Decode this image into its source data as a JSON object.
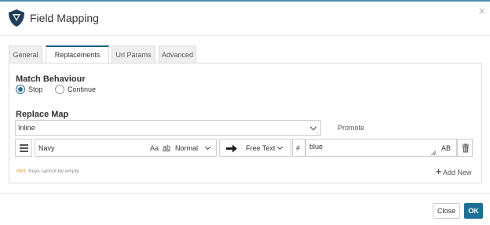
{
  "dialog": {
    "title": "Field Mapping",
    "close_symbol": "×"
  },
  "tabs": [
    {
      "label": "General",
      "active": false
    },
    {
      "label": "Replacements",
      "active": true
    },
    {
      "label": "Url Params",
      "active": false
    },
    {
      "label": "Advanced",
      "active": false
    }
  ],
  "match_behaviour": {
    "label": "Match Behaviour",
    "options": [
      {
        "label": "Stop",
        "selected": true
      },
      {
        "label": "Continue",
        "selected": false
      }
    ]
  },
  "replace_map": {
    "label": "Replace Map",
    "type_select": {
      "value": "Inline"
    },
    "promote_label": "Promote",
    "rows": [
      {
        "key": "Navy",
        "case_toggle": "Aa",
        "word_toggle": "ab",
        "match_mode": "Normal",
        "replace_type": "Free Text",
        "hash_symbol": "#",
        "value": "blue",
        "value_format": "AB"
      }
    ],
    "hint_tag": "Hint:",
    "hint_text": "Keys cannot be empty",
    "add_new_label": "Add New"
  },
  "footer": {
    "close_label": "Close",
    "ok_label": "OK"
  },
  "colors": {
    "accent": "#1e6f96",
    "tab_active_border": "#1e5f80",
    "hint": "#d79a2b"
  },
  "icons": {
    "logo": "shield-logo-icon",
    "close": "close-icon",
    "drag": "hamburger-icon",
    "arrow": "arrow-right-icon",
    "delete": "trash-icon",
    "add": "plus-icon"
  }
}
